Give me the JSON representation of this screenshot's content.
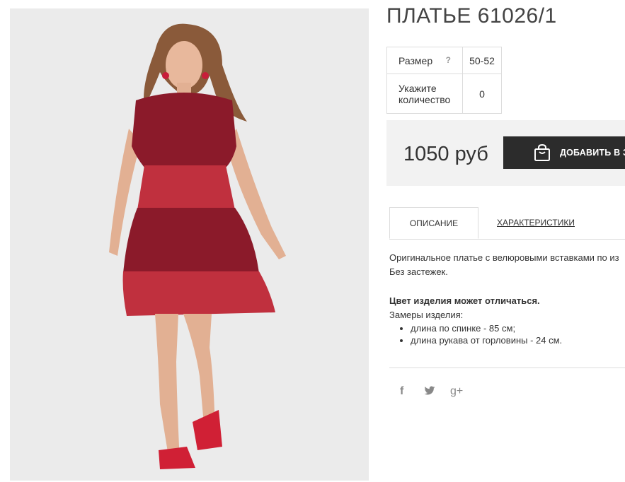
{
  "product": {
    "title": "ПЛАТЬЕ 61026/1",
    "image_alt": "Платье 61026/1"
  },
  "options": {
    "size_label": "Размер",
    "size_help": "?",
    "size_value": "50-52",
    "qty_label": "Укажите количество",
    "qty_value": "0"
  },
  "buy": {
    "price": "1050 руб",
    "cart_label": "ДОБАВИТЬ В ЗАКАЗ",
    "cart_icon": "shopping-bag-icon"
  },
  "tabs": {
    "description": "ОПИСАНИЕ",
    "characteristics": "ХАРАКТЕРИСТИКИ"
  },
  "description": {
    "line1": "Оригинальное платье с велюровыми вставками по из",
    "line2": "Без застежек.",
    "color_note": "Цвет изделия может отличаться.",
    "measures_title": "Замеры изделия:",
    "measures": [
      "длина по спинке - 85 см;",
      "длина рукава от горловины - 24 см."
    ]
  },
  "social": {
    "facebook": "f",
    "twitter": "🐦",
    "gplus": "g+"
  },
  "colors": {
    "dress": "#8b1a2a",
    "velvet": "#c0303e",
    "button": "#2c2c2c",
    "price_bg": "#f2f2f2"
  }
}
